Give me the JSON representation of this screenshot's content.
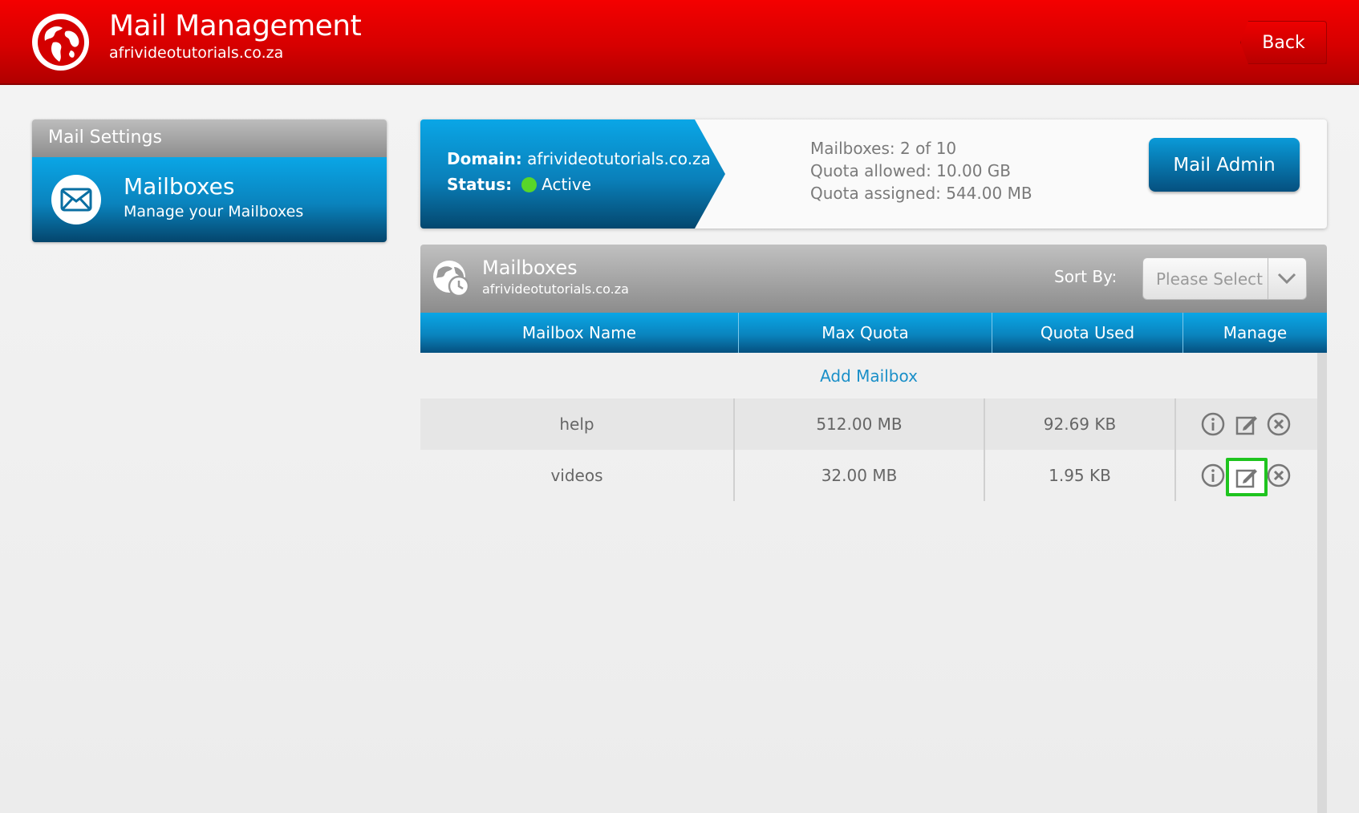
{
  "header": {
    "title": "Mail Management",
    "subtitle": "afrivideotutorials.co.za",
    "back_label": "Back",
    "logo_icon": "globe-icon"
  },
  "sidebar": {
    "section_title": "Mail Settings",
    "items": [
      {
        "title": "Mailboxes",
        "subtitle": "Manage your Mailboxes",
        "icon": "envelope-icon"
      }
    ]
  },
  "domain_card": {
    "domain_label": "Domain:",
    "domain_value": "afrivideotutorials.co.za",
    "status_label": "Status:",
    "status_value": "Active",
    "status_color": "#58d62a",
    "stats": [
      "Mailboxes: 2 of 10",
      "Quota allowed: 10.00 GB",
      "Quota assigned: 544.00 MB"
    ],
    "admin_button": "Mail Admin"
  },
  "mailboxes_panel": {
    "title": "Mailboxes",
    "subtitle": "afrivideotutorials.co.za",
    "sort_label": "Sort By:",
    "sort_value": "Please Select",
    "columns": [
      "Mailbox Name",
      "Max Quota",
      "Quota Used",
      "Manage"
    ],
    "add_link": "Add Mailbox",
    "rows": [
      {
        "name": "help",
        "max_quota": "512.00 MB",
        "quota_used": "92.69 KB"
      },
      {
        "name": "videos",
        "max_quota": "32.00 MB",
        "quota_used": "1.95 KB"
      }
    ],
    "manage_icons": [
      "info-icon",
      "edit-icon",
      "delete-icon"
    ],
    "highlight_color": "#1fc41f"
  },
  "colors": {
    "header_red": "#e00000",
    "accent_blue": "#0a8fcf"
  }
}
